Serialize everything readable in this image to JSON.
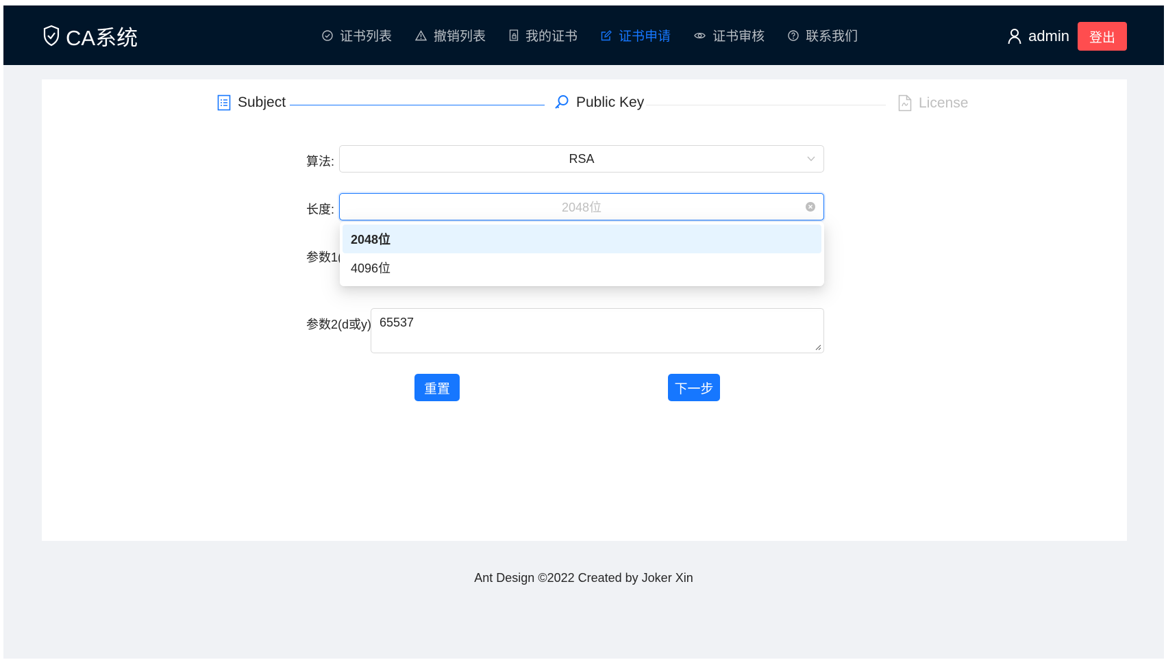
{
  "header": {
    "app_title": "CA系统",
    "nav": [
      {
        "label": "证书列表",
        "icon": "check-circle-icon",
        "active": false
      },
      {
        "label": "撤销列表",
        "icon": "warning-icon",
        "active": false
      },
      {
        "label": "我的证书",
        "icon": "file-lock-icon",
        "active": false
      },
      {
        "label": "证书申请",
        "icon": "edit-icon",
        "active": true
      },
      {
        "label": "证书审核",
        "icon": "eye-icon",
        "active": false
      },
      {
        "label": "联系我们",
        "icon": "question-circle-icon",
        "active": false
      }
    ],
    "user_name": "admin",
    "logout_label": "登出",
    "accent_color": "#1677ff",
    "logout_color": "#ff4d4f"
  },
  "steps": [
    {
      "label": "Subject",
      "icon": "profile-icon",
      "status": "finished"
    },
    {
      "label": "Public Key",
      "icon": "key-icon",
      "status": "current"
    },
    {
      "label": "License",
      "icon": "file-icon",
      "status": "waiting"
    }
  ],
  "form": {
    "algorithm_label": "算法:",
    "algorithm_value": "RSA",
    "length_label": "长度:",
    "length_placeholder": "2048位",
    "length_options": [
      {
        "label": "2048位",
        "selected": true
      },
      {
        "label": "4096位",
        "selected": false
      }
    ],
    "param1_label": "参数1(",
    "param2_label": "参数2(d或y):",
    "param2_value": "65537",
    "reset_label": "重置",
    "next_label": "下一步"
  },
  "footer": {
    "text": "Ant Design ©2022 Created by Joker Xin"
  }
}
